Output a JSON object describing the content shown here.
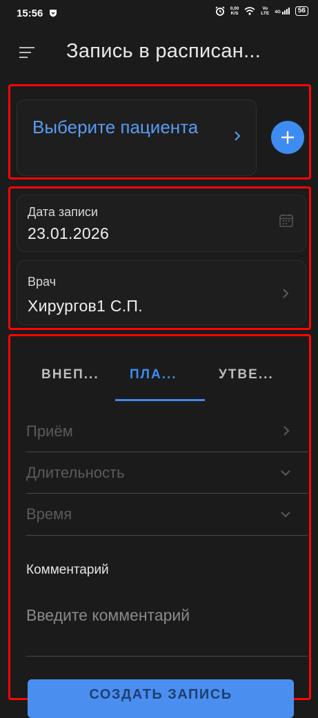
{
  "status_bar": {
    "time": "15:56",
    "net_speed_value": "0,00",
    "net_speed_unit": "K/S",
    "net_label_top": "Vo",
    "net_label_bottom": "LTE",
    "net_type": "4G",
    "battery": "56"
  },
  "header": {
    "title": "Запись в расписан..."
  },
  "patient": {
    "label": "Выберите пациента"
  },
  "date_field": {
    "label": "Дата записи",
    "value": "23.01.2026"
  },
  "doctor_field": {
    "label": "Врач",
    "value": "Хирургов1 С.П."
  },
  "tabs": [
    {
      "label": "ВНЕП..."
    },
    {
      "label": "ПЛА..."
    },
    {
      "label": "УТВЕ..."
    }
  ],
  "form": {
    "reception_label": "Приём",
    "duration_label": "Длительность",
    "time_label": "Время",
    "comment_label": "Комментарий",
    "comment_placeholder": "Введите комментарий"
  },
  "create_button": "СОЗДАТЬ ЗАПИСЬ",
  "colors": {
    "background": "#1b1b1b",
    "accent": "#3f8cf0",
    "highlight": "#ff0606"
  }
}
